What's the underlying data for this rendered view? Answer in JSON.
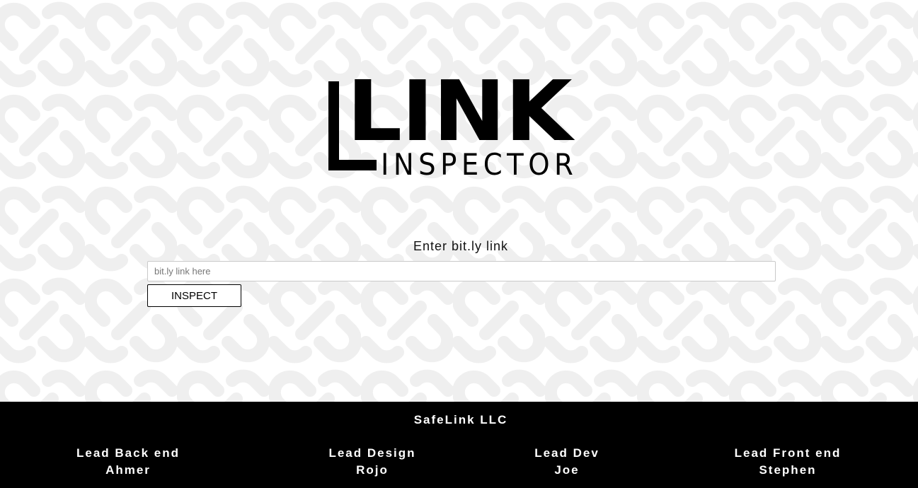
{
  "logo": {
    "primary": "LINK",
    "secondary": "INSPECTOR"
  },
  "form": {
    "label": "Enter bit.ly link",
    "input_placeholder": "bit.ly link here",
    "input_value": "",
    "button_label": "INSPECT"
  },
  "footer": {
    "company": "SafeLink LLC",
    "credits": [
      {
        "role": "Lead Back end",
        "name": "Ahmer"
      },
      {
        "role": "Lead Design",
        "name": "Rojo"
      },
      {
        "role": "Lead Dev",
        "name": "Joe"
      },
      {
        "role": "Lead Front end",
        "name": "Stephen"
      }
    ]
  },
  "colors": {
    "background": "#ffffff",
    "pattern": "#f0f0f0",
    "footer_background": "#000000",
    "footer_text": "#ffffff",
    "logo": "#000000"
  },
  "icons": {
    "background_pattern": "chain-link-icon"
  }
}
